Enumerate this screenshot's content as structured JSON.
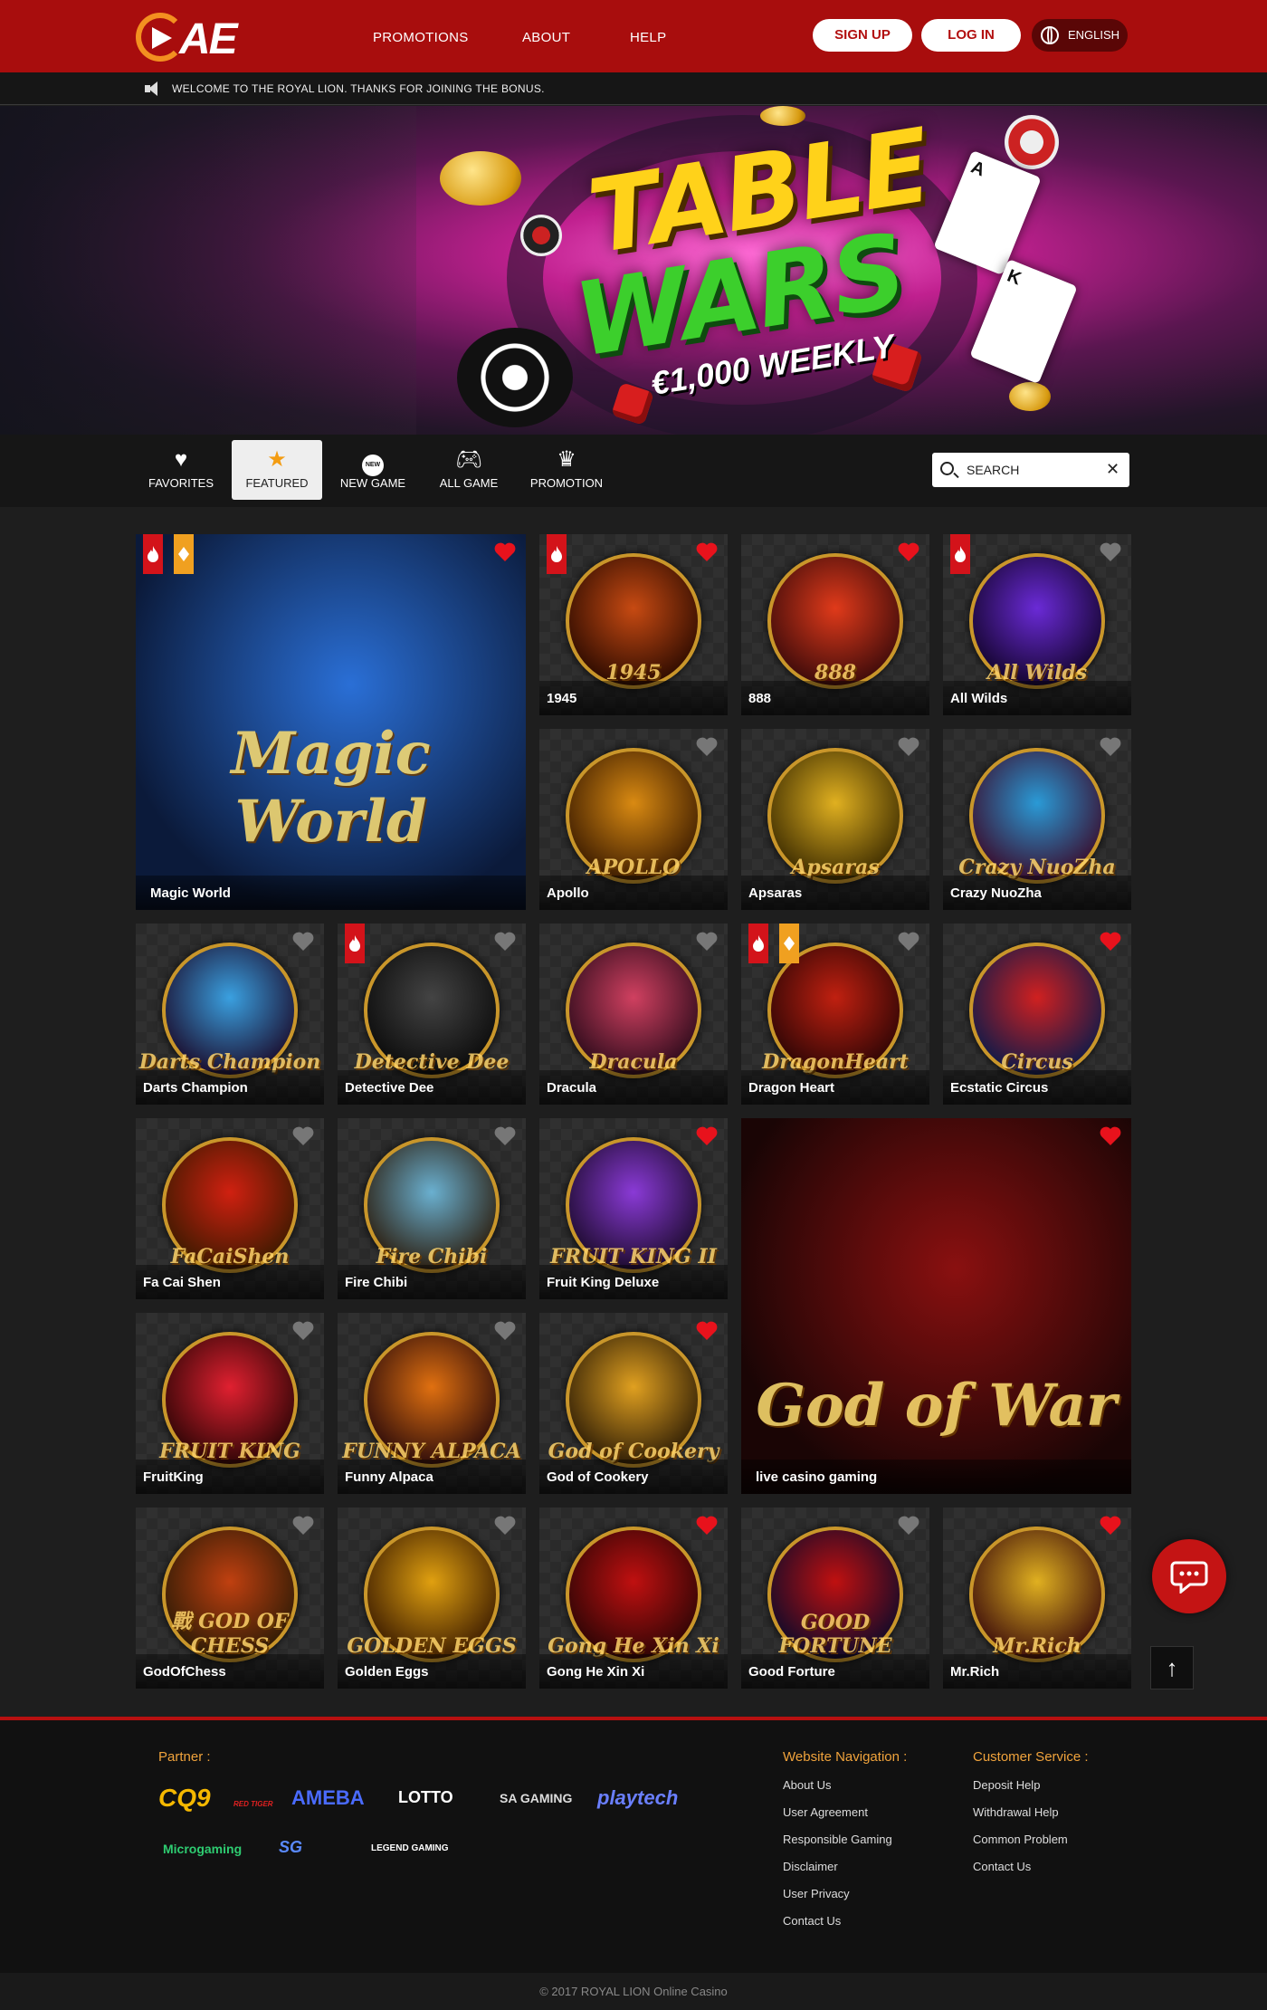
{
  "header": {
    "logo": "AE",
    "nav": [
      "PROMOTIONS",
      "ABOUT",
      "HELP"
    ],
    "signup": "SIGN UP",
    "login": "LOG IN",
    "language": "ENGLISH",
    "brand_color": "#a80d0d"
  },
  "marquee": {
    "message": "WELCOME TO THE ROYAL LION. THANKS FOR JOINING THE BONUS."
  },
  "banner": {
    "line1": "TABLE",
    "line2": "WARS",
    "line3": "€1,000 WEEKLY"
  },
  "tabs": [
    {
      "label": "FAVORITES",
      "icon": "heart-icon"
    },
    {
      "label": "FEATURED",
      "icon": "star-icon",
      "active": true
    },
    {
      "label": "NEW GAME",
      "icon": "new-badge-icon"
    },
    {
      "label": "ALL GAME",
      "icon": "gamepad-icon"
    },
    {
      "label": "PROMOTION",
      "icon": "crown-icon"
    }
  ],
  "search": {
    "placeholder": "SEARCH"
  },
  "games": [
    {
      "name": "Magic World",
      "favorite": true,
      "badges": [
        "fire",
        "diamond"
      ],
      "art": "Magic World"
    },
    {
      "name": "1945",
      "favorite": true,
      "badges": [
        "fire"
      ],
      "art": "1945"
    },
    {
      "name": "888",
      "favorite": true,
      "badges": [],
      "art": "888"
    },
    {
      "name": "All Wilds",
      "favorite": false,
      "badges": [
        "fire"
      ],
      "art": "All Wilds"
    },
    {
      "name": "Apollo",
      "favorite": false,
      "badges": [],
      "art": "APOLLO"
    },
    {
      "name": "Apsaras",
      "favorite": false,
      "badges": [],
      "art": "Apsaras"
    },
    {
      "name": "Crazy NuoZha",
      "favorite": false,
      "badges": [],
      "art": "Crazy NuoZha"
    },
    {
      "name": "Darts Champion",
      "favorite": false,
      "badges": [],
      "art": "Darts Champion"
    },
    {
      "name": "Detective Dee",
      "favorite": false,
      "badges": [
        "fire"
      ],
      "art": "Detective Dee"
    },
    {
      "name": "Dracula",
      "favorite": false,
      "badges": [],
      "art": "Dracula"
    },
    {
      "name": "Dragon Heart",
      "favorite": false,
      "badges": [
        "fire",
        "diamond"
      ],
      "art": "DragonHeart"
    },
    {
      "name": "Ecstatic Circus",
      "favorite": true,
      "badges": [],
      "art": "Circus"
    },
    {
      "name": "Fa Cai Shen",
      "favorite": false,
      "badges": [],
      "art": "FaCaiShen"
    },
    {
      "name": "Fire Chibi",
      "favorite": false,
      "badges": [],
      "art": "Fire Chibi"
    },
    {
      "name": "Fruit King Deluxe",
      "favorite": true,
      "badges": [],
      "art": "FRUIT KING II"
    },
    {
      "name": "live casino gaming",
      "favorite": true,
      "badges": [],
      "art": "God of War"
    },
    {
      "name": "FruitKing",
      "favorite": false,
      "badges": [],
      "art": "FRUIT KING"
    },
    {
      "name": "Funny Alpaca",
      "favorite": false,
      "badges": [],
      "art": "FUNNY ALPACA"
    },
    {
      "name": "God of Cookery",
      "favorite": true,
      "badges": [],
      "art": "God of Cookery"
    },
    {
      "name": "GodOfChess",
      "favorite": false,
      "badges": [],
      "art": "戰 GOD OF CHESS"
    },
    {
      "name": "Golden Eggs",
      "favorite": false,
      "badges": [],
      "art": "GOLDEN EGGS"
    },
    {
      "name": "Gong He Xin Xi",
      "favorite": true,
      "badges": [],
      "art": "Gong He Xin Xi"
    },
    {
      "name": "Good Forture",
      "favorite": false,
      "badges": [],
      "art": "GOOD FORTUNE"
    },
    {
      "name": "Mr.Rich",
      "favorite": true,
      "badges": [],
      "art": "Mr.Rich"
    }
  ],
  "floating": {
    "chat_icon": "chat-bubble-icon",
    "top_arrow": "↑"
  },
  "footer": {
    "partner_heading": "Partner :",
    "partners": [
      "CQ9",
      "RED TIGER",
      "AMEBA",
      "LOTTO",
      "SA GAMING",
      "playtech",
      "Microgaming",
      "SG",
      "LEGEND GAMING"
    ],
    "nav_heading": "Website Navigation :",
    "nav_links": [
      "About Us",
      "User Agreement",
      "Responsible Gaming",
      "Disclaimer",
      "User Privacy",
      "Contact Us"
    ],
    "service_heading": "Customer Service :",
    "service_links": [
      "Deposit Help",
      "Withdrawal Help",
      "Common Problem",
      "Contact Us"
    ],
    "copyright": "© 2017 ROYAL LION Online Casino"
  }
}
